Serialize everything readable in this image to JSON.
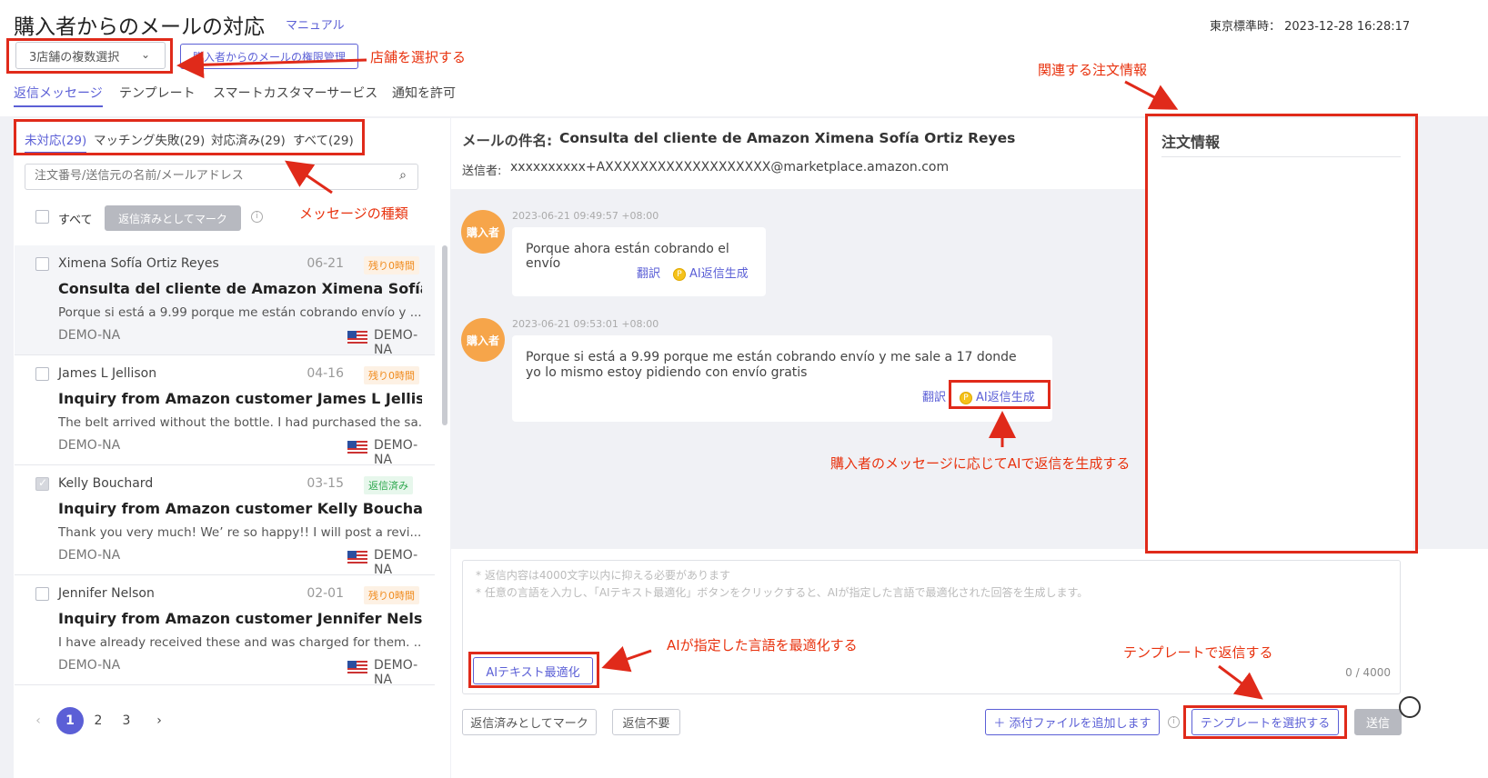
{
  "header": {
    "title": "購入者からのメールの対応",
    "manual_link": "マニュアル",
    "timestamp": "東京標準時：  2023-12-28 16:28:17"
  },
  "toolbar": {
    "store_select_value": "3店舗の複数選択",
    "permission_button": "購入者からのメールの権限管理"
  },
  "nav_tabs": [
    "返信メッセージ",
    "テンプレート",
    "スマートカスタマーサービス",
    "通知を許可"
  ],
  "filter_tabs": [
    "未対応(29)",
    "マッチング失敗(29)",
    "対応済み(29)",
    "すべて(29)"
  ],
  "search": {
    "placeholder": "注文番号/送信元の名前/メールアドレス"
  },
  "select_all": {
    "label": "すべて",
    "mark_button": "返信済みとしてマーク"
  },
  "messages": [
    {
      "sender": "Ximena Sofía Ortiz Reyes",
      "date": "06-21",
      "badge": "残り0時間",
      "subject": "Consulta del cliente de Amazon Ximena Sofía O...",
      "preview": "Porque si está a 9.99 porque me están cobrando envío y ...",
      "store": "DEMO-NA",
      "region": "DEMO-NA"
    },
    {
      "sender": "James L Jellison",
      "date": "04-16",
      "badge": "残り0時間",
      "subject": "Inquiry from Amazon customer James L Jellison...",
      "preview": "The belt arrived without the bottle. I had purchased the sa...",
      "store": "DEMO-NA",
      "region": "DEMO-NA"
    },
    {
      "sender": "Kelly Bouchard",
      "date": "03-15",
      "badge": "返信済み",
      "subject": "Inquiry from Amazon customer Kelly Bouchard(...",
      "preview": "Thank you very much! We’ re so happy!! I will post a revi...",
      "store": "DEMO-NA",
      "region": "DEMO-NA"
    },
    {
      "sender": "Jennifer Nelson",
      "date": "02-01",
      "badge": "残り0時間",
      "subject": "Inquiry from Amazon customer Jennifer Nelson...",
      "preview": "I have already received these and was charged for them. ...",
      "store": "DEMO-NA",
      "region": "DEMO-NA"
    }
  ],
  "pagination": {
    "prev": "‹",
    "pages": [
      "1",
      "2",
      "3"
    ],
    "next": "›"
  },
  "mail": {
    "subject_label": "メールの件名:",
    "subject": "Consulta del cliente de Amazon Ximena Sofía Ortiz Reyes",
    "sender_label": "送信者:",
    "sender": "xxxxxxxxxx+AXXXXXXXXXXXXXXXXXXX@marketplace.amazon.com"
  },
  "conversation": [
    {
      "avatar": "購入者",
      "time": "2023-06-21 09:49:57 +08:00",
      "text": "Porque ahora están cobrando el envío",
      "translate": "翻訳",
      "ai_reply": "AI返信生成"
    },
    {
      "avatar": "購入者",
      "time": "2023-06-21 09:53:01 +08:00",
      "text": "Porque si está a 9.99 porque me están cobrando envío y me sale a 17 donde yo lo mismo estoy pidiendo con envío gratis",
      "translate": "翻訳",
      "ai_reply": "AI返信生成"
    }
  ],
  "reply_box": {
    "hint1": "* 返信内容は4000文字以内に抑える必要があります",
    "hint2": "* 任意の言語を入力し、「AIテキスト最適化」ボタンをクリックすると、AIが指定した言語で最適化された回答を生成します。",
    "ai_optimize_button": "AIテキスト最適化",
    "counter": "0 / 4000"
  },
  "footer_buttons": {
    "mark_replied": "返信済みとしてマーク",
    "no_reply": "返信不要",
    "attach": "＋ 添付ファイルを追加します",
    "template": "テンプレートを選択する",
    "send": "送信"
  },
  "order_panel": {
    "title": "注文情報"
  },
  "annotations": {
    "store_select": "店舗を選択する",
    "related_order": "関連する注文情報",
    "message_types": "メッセージの種類",
    "ai_generate": "購入者のメッセージに応じてAIで返信を生成する",
    "ai_optimize": "AIが指定した言語を最適化する",
    "template_reply": "テンプレートで返信する"
  },
  "colors": {
    "accent": "#5b5fd6",
    "annotation_red": "#e02a1a",
    "avatar_orange": "#f6a54a"
  }
}
